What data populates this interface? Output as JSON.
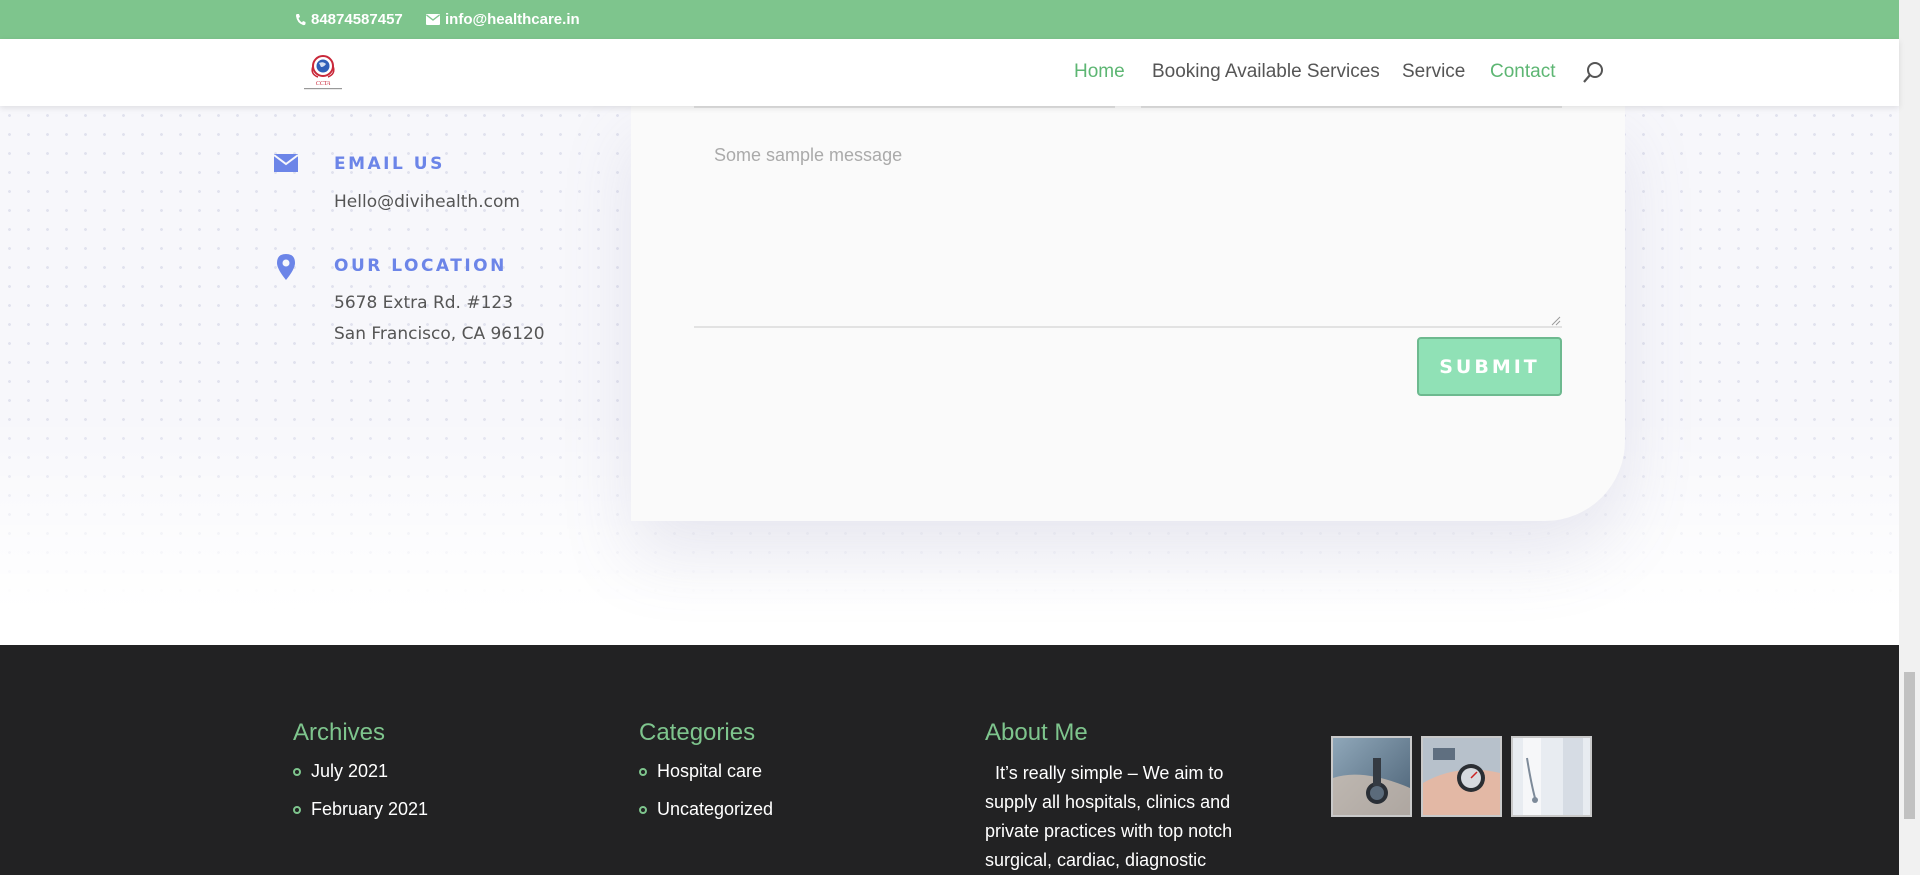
{
  "topbar": {
    "phone": "84874587457",
    "email": "info@healthcare.in",
    "bg_color": "#7ec58d"
  },
  "header": {
    "logo_icon": "hospital-globe-logo",
    "nav": [
      {
        "label": "Home",
        "active": true
      },
      {
        "label": "Booking Available Services",
        "active": false
      },
      {
        "label": "Service",
        "active": false
      },
      {
        "label": "Contact",
        "active": true
      }
    ],
    "search_icon": "search-icon"
  },
  "contact_info": {
    "partial_text": "(…)",
    "email": {
      "title": "EMAIL US",
      "value": "Hello@divihealth.com",
      "icon": "envelope-icon"
    },
    "location": {
      "title": "OUR LOCATION",
      "line1": "5678 Extra Rd. #123",
      "line2": "San Francisco, CA 96120",
      "icon": "map-pin-icon"
    },
    "accent_color": "#6c85e8"
  },
  "form": {
    "message_placeholder": "Some sample message",
    "submit_label": "SUBMIT",
    "submit_color": "#90e1b6"
  },
  "footer": {
    "archives": {
      "title": "Archives",
      "items": [
        "July 2021",
        "February 2021"
      ]
    },
    "categories": {
      "title": "Categories",
      "items": [
        "Hospital care",
        "Uncategorized"
      ]
    },
    "about": {
      "title": "About Me",
      "text": "  It’s really simple – We aim to supply all hospitals, clinics and private practices with top notch surgical, cardiac, diagnostic"
    },
    "gallery": [
      "watch-on-wrist-photo",
      "blood-pressure-gauge-photo",
      "doctor-coat-photo"
    ],
    "title_color": "#7ec58d"
  }
}
